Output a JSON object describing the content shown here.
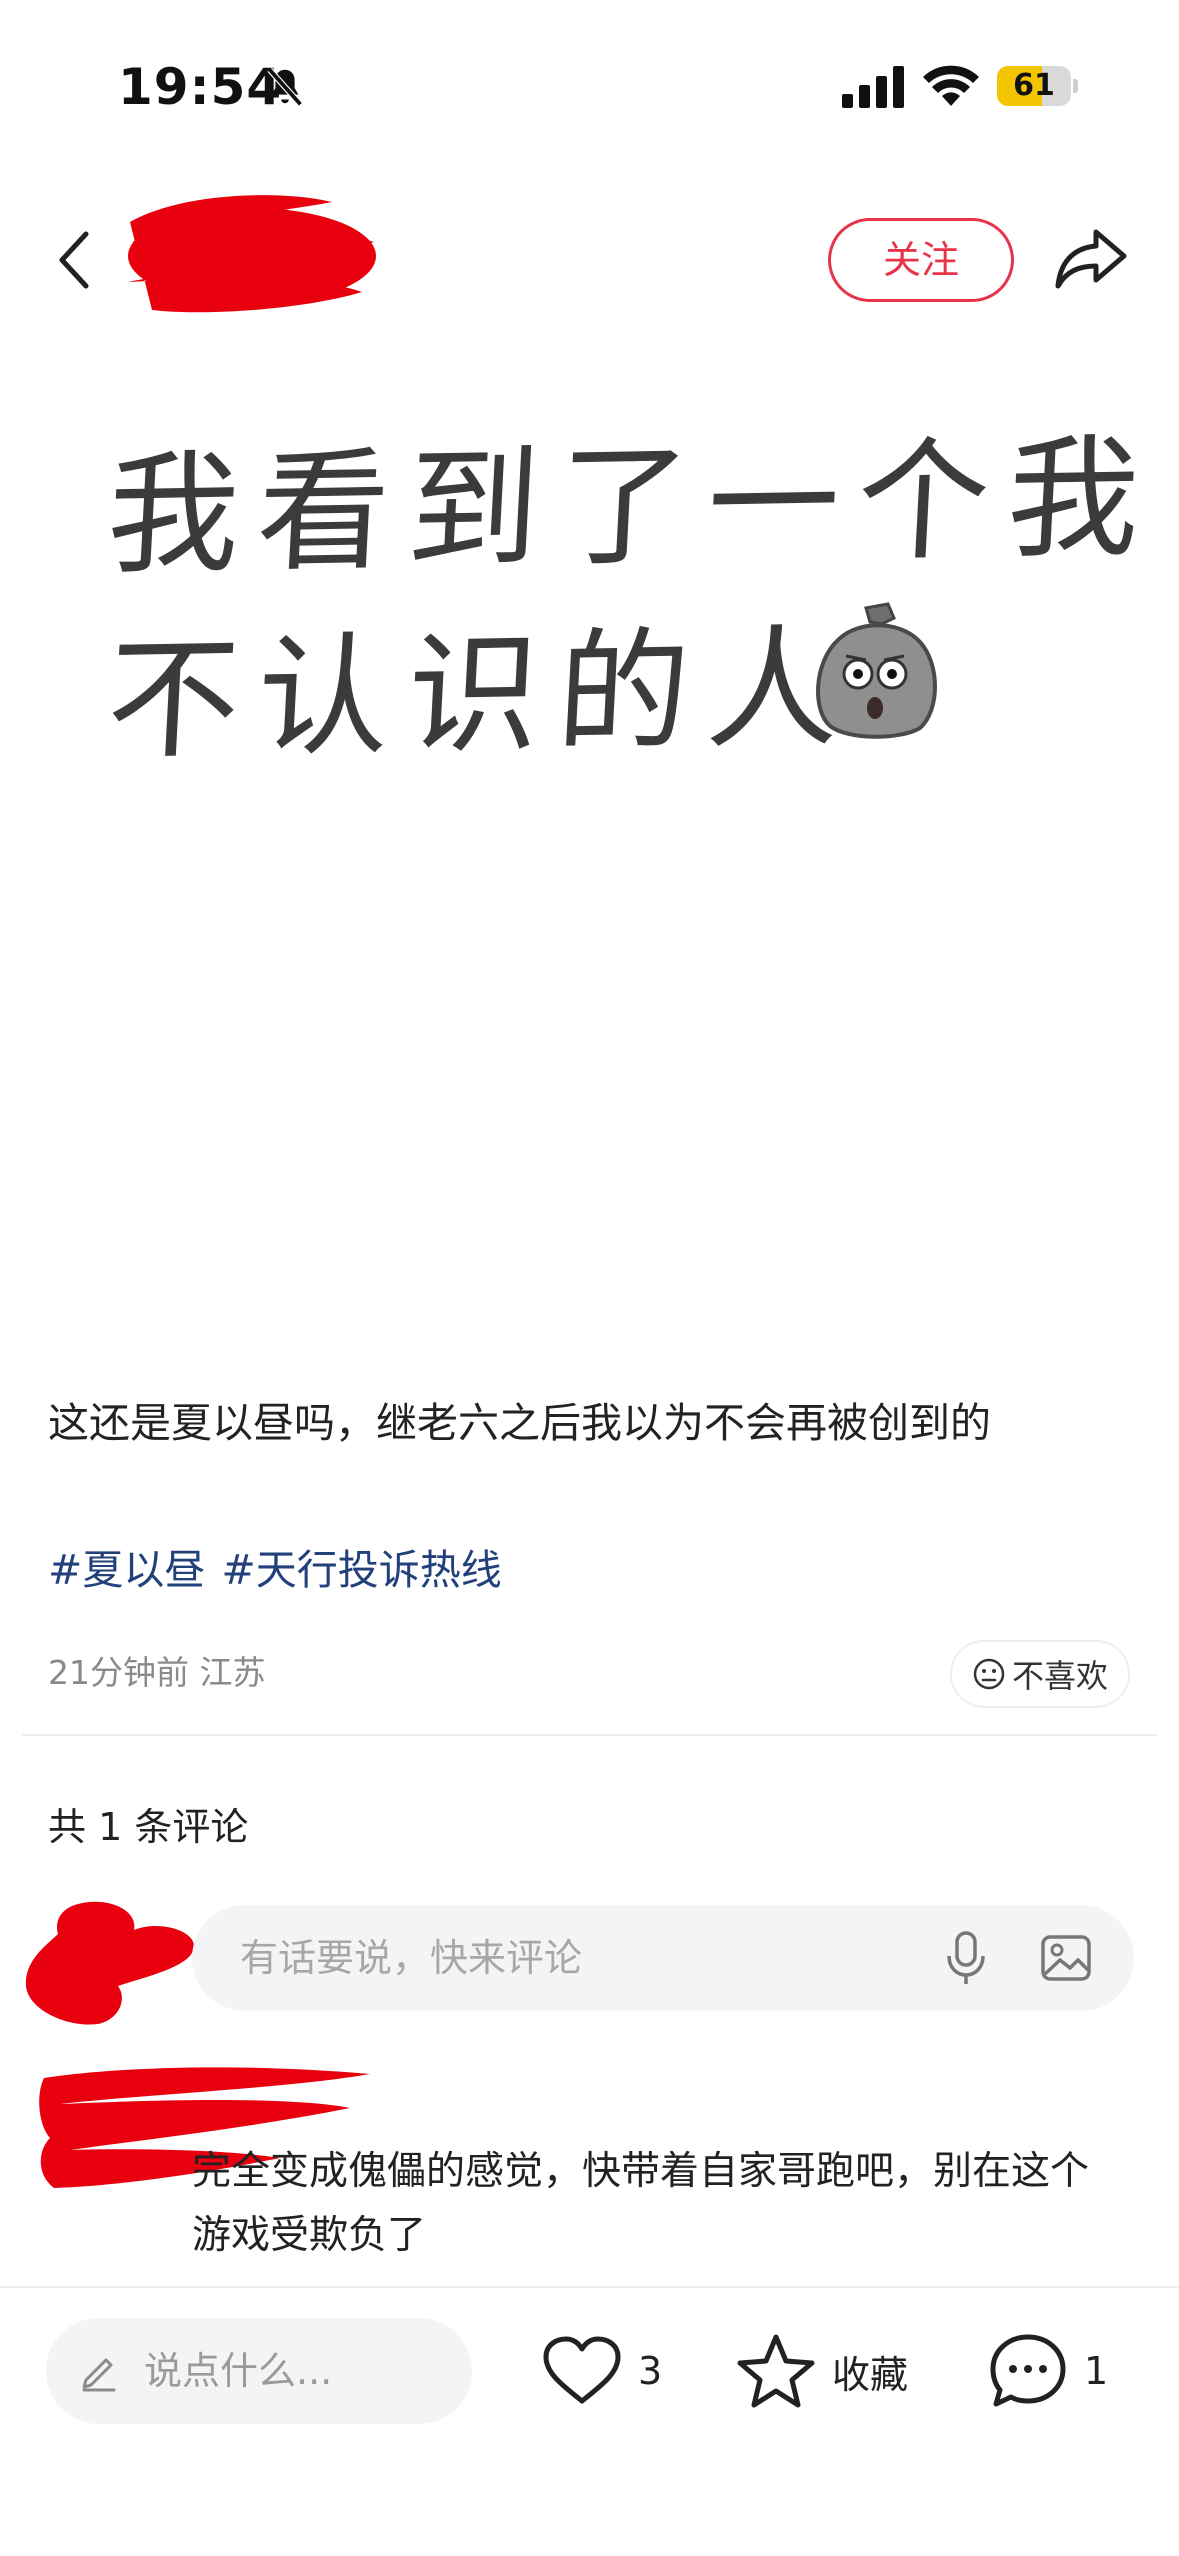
{
  "status_bar": {
    "time": "19:54",
    "battery_level": "61",
    "battery_fraction": 0.61,
    "icons": [
      "bell-slash-icon",
      "signal-icon",
      "wifi-icon",
      "battery-icon"
    ]
  },
  "nav": {
    "back_icon": "chevron-left-icon",
    "follow_label": "关注",
    "share_icon": "share-arrow-icon",
    "accent_color": "#e8344a"
  },
  "post_image": {
    "line1": "我看到了一个我",
    "line2": "不认识的人",
    "emoji": "shocked-sack-emoji"
  },
  "post": {
    "text": "这还是夏以昼吗，继老六之后我以为不会再被创到的",
    "tags": [
      "#夏以昼",
      "#天行投诉热线"
    ],
    "meta": "21分钟前 江苏",
    "dislike_label": "不喜欢",
    "tag_color": "#22407a"
  },
  "comments": {
    "count_label": "共 1 条评论",
    "input_placeholder": "有话要说，快来评论",
    "items": [
      {
        "text": "完全变成傀儡的感觉，快带着自家哥跑吧，别在这个游戏受欺负了"
      }
    ]
  },
  "bottom_bar": {
    "say_placeholder": "说点什么...",
    "like_count": "3",
    "favorite_label": "收藏",
    "comment_count": "1"
  }
}
